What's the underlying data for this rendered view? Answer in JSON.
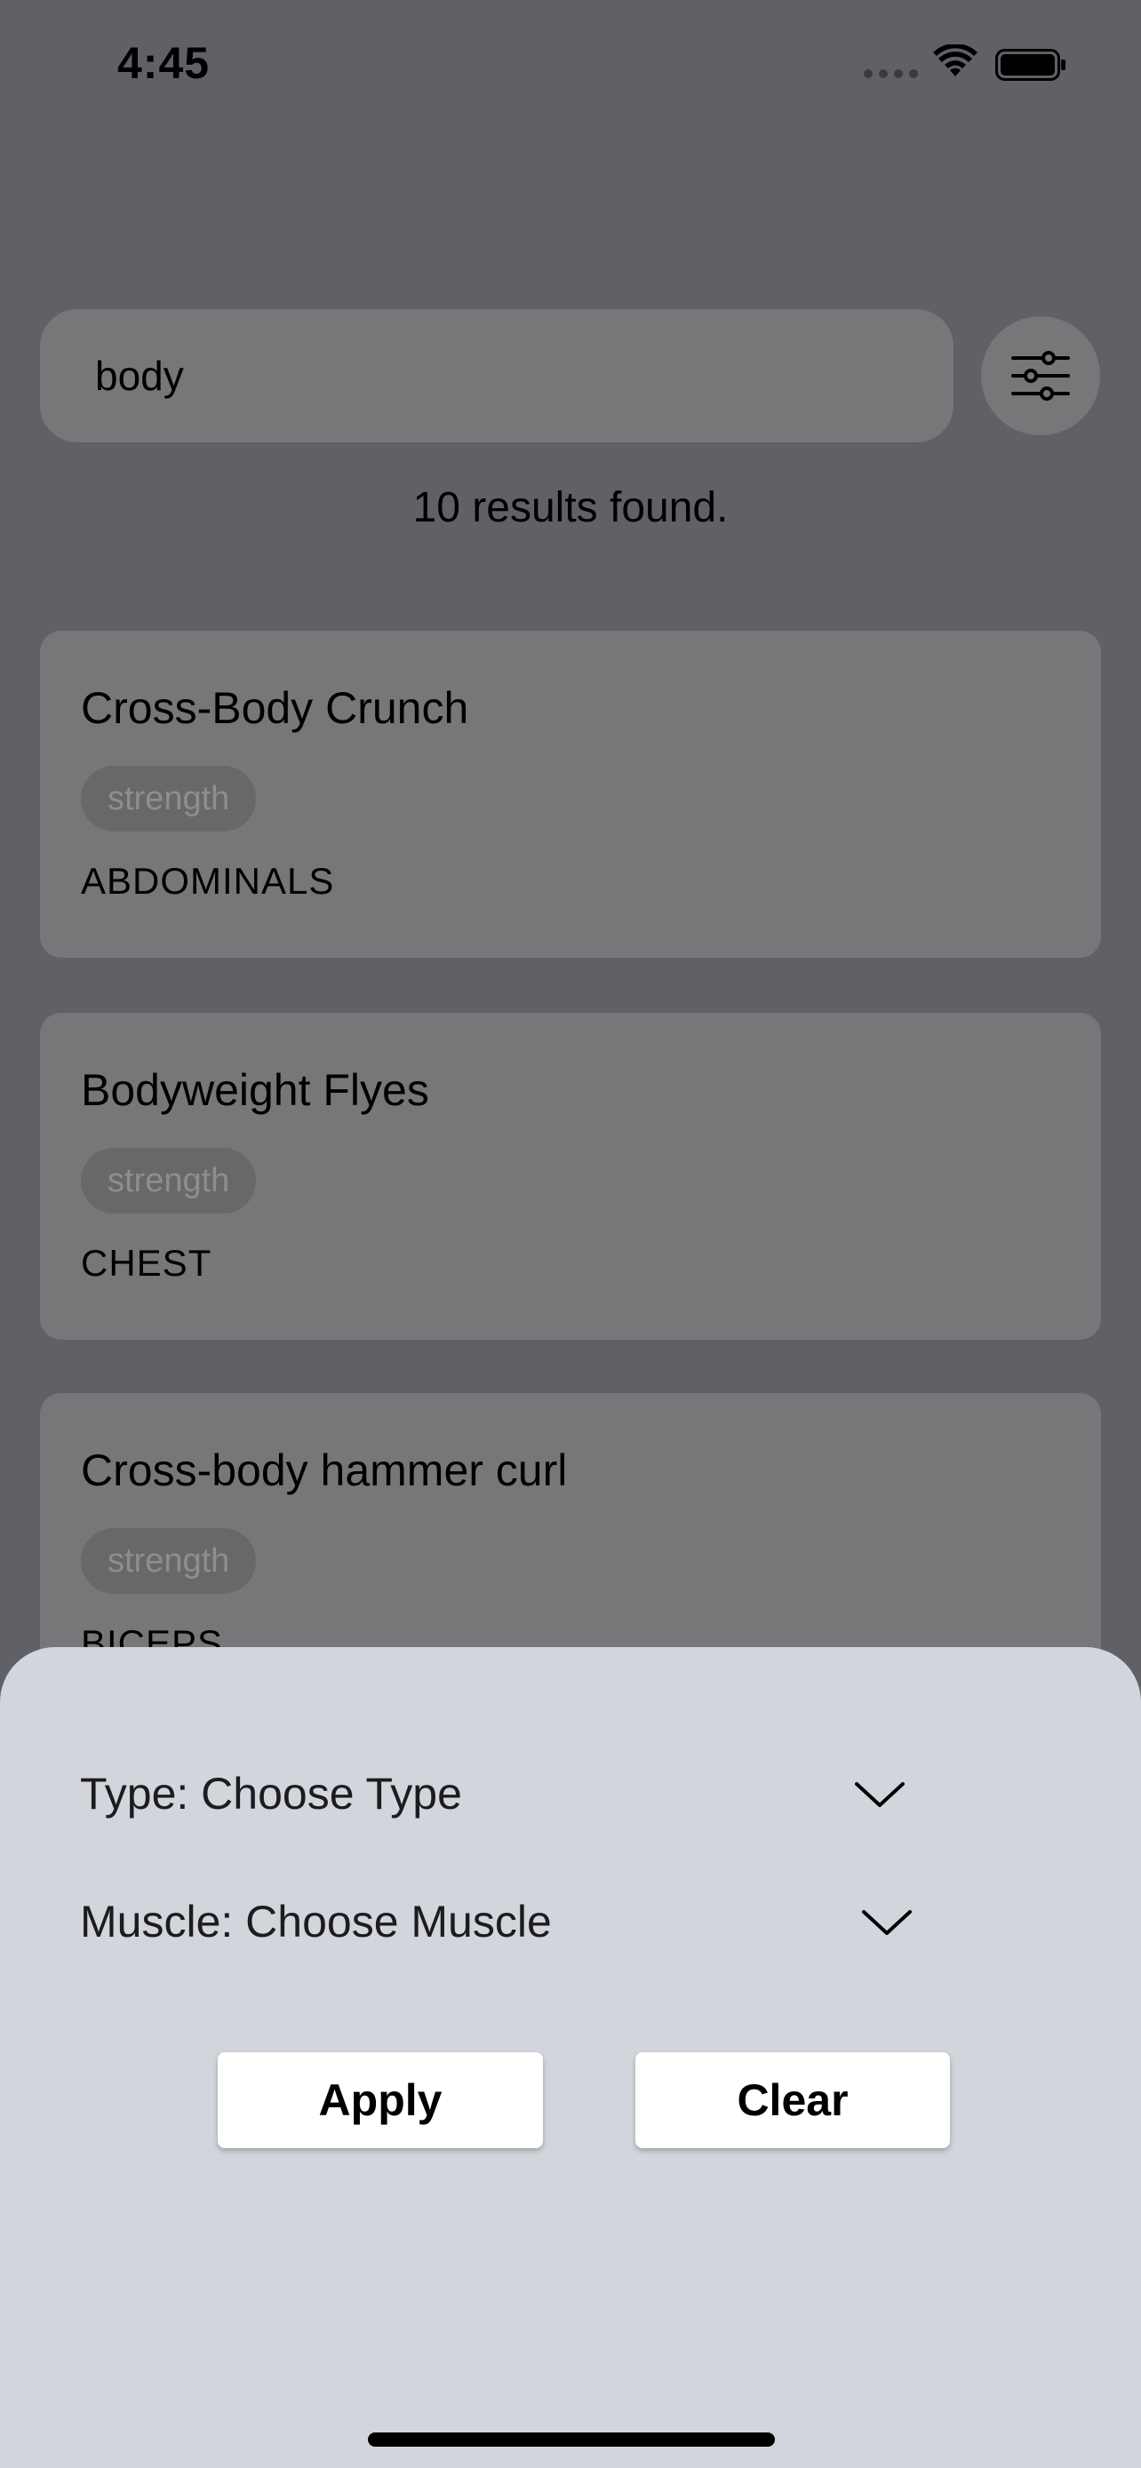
{
  "status_bar": {
    "time": "4:45"
  },
  "search": {
    "query": "body"
  },
  "results_text": "10 results found.",
  "exercises": [
    {
      "name": "Cross-Body Crunch",
      "type": "strength",
      "muscle": "ABDOMINALS"
    },
    {
      "name": "Bodyweight Flyes",
      "type": "strength",
      "muscle": "CHEST"
    },
    {
      "name": "Cross-body hammer curl",
      "type": "strength",
      "muscle": "BICEPS"
    }
  ],
  "filter_sheet": {
    "type_label": "Type: Choose Type",
    "muscle_label": "Muscle: Choose Muscle",
    "apply_label": "Apply",
    "clear_label": "Clear"
  },
  "colors": {
    "overlay_background": "#606166",
    "card_background": "#77777a",
    "sheet_background": "#d3d5dd"
  }
}
